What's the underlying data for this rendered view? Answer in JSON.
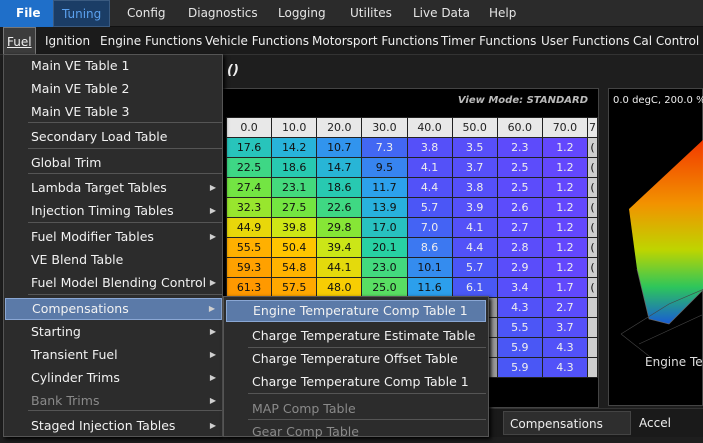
{
  "top_menu": [
    "File",
    "Tuning",
    "Config",
    "Diagnostics",
    "Logging",
    "Utilites",
    "Live Data",
    "Help"
  ],
  "second_menu": [
    "Fuel",
    "Ignition",
    "Engine Functions",
    "Vehicle Functions",
    "Motorsport Functions",
    "Timer Functions",
    "User Functions",
    "Cal Control"
  ],
  "title_fragment": "()",
  "view_mode": "View Mode: STANDARD",
  "table": {
    "headers": [
      "0.0",
      "10.0",
      "20.0",
      "30.0",
      "40.0",
      "50.0",
      "60.0",
      "70.0",
      "7"
    ],
    "rows": [
      [
        "17.6",
        "14.2",
        "10.7",
        "7.3",
        "3.8",
        "3.5",
        "2.3",
        "1.2",
        "("
      ],
      [
        "22.5",
        "18.6",
        "14.7",
        "9.5",
        "4.1",
        "3.7",
        "2.5",
        "1.2",
        "("
      ],
      [
        "27.4",
        "23.1",
        "18.6",
        "11.7",
        "4.4",
        "3.8",
        "2.5",
        "1.2",
        "("
      ],
      [
        "32.3",
        "27.5",
        "22.6",
        "13.9",
        "5.7",
        "3.9",
        "2.6",
        "1.2",
        "("
      ],
      [
        "44.9",
        "39.8",
        "29.8",
        "17.0",
        "7.0",
        "4.1",
        "2.7",
        "1.2",
        "("
      ],
      [
        "55.5",
        "50.4",
        "39.4",
        "20.1",
        "8.6",
        "4.4",
        "2.8",
        "1.2",
        "("
      ],
      [
        "59.3",
        "54.8",
        "44.1",
        "23.0",
        "10.1",
        "5.7",
        "2.9",
        "1.2",
        "("
      ],
      [
        "61.3",
        "57.5",
        "48.0",
        "25.0",
        "11.6",
        "6.1",
        "3.4",
        "1.7",
        "("
      ],
      [
        "",
        "",
        "",
        "",
        "",
        "",
        "4.3",
        "2.7",
        ""
      ],
      [
        "",
        "",
        "",
        "",
        "",
        "",
        "5.5",
        "3.7",
        ""
      ],
      [
        "",
        "",
        "",
        "",
        "",
        "",
        "5.9",
        "4.3",
        ""
      ],
      [
        "",
        "",
        "",
        "",
        "",
        "",
        "5.9",
        "4.3",
        ""
      ]
    ]
  },
  "surface": {
    "header": "0.0 degC, 200.0 %",
    "label": "Engine Te"
  },
  "bottom_tabs": [
    "Compensations",
    "Accel"
  ],
  "fuel_menu": [
    {
      "label": "Main VE Table 1"
    },
    {
      "label": "Main VE Table 2"
    },
    {
      "label": "Main VE Table 3"
    },
    {
      "label": "Secondary Load Table"
    },
    {
      "label": "Global Trim"
    },
    {
      "label": "Lambda Target Tables",
      "submenu": true
    },
    {
      "label": "Injection Timing Tables",
      "submenu": true
    },
    {
      "label": "Fuel Modifier Tables",
      "submenu": true
    },
    {
      "label": "VE Blend Table"
    },
    {
      "label": "Fuel Model Blending Control",
      "submenu": true
    },
    {
      "label": "Compensations",
      "submenu": true
    },
    {
      "label": "Starting",
      "submenu": true
    },
    {
      "label": "Transient Fuel",
      "submenu": true
    },
    {
      "label": "Cylinder Trims",
      "submenu": true
    },
    {
      "label": "Bank Trims",
      "submenu": true
    },
    {
      "label": "Staged Injection Tables",
      "submenu": true
    }
  ],
  "submenu_items": [
    {
      "label": "Engine Temperature Comp Table 1"
    },
    {
      "label": "Charge Temperature Estimate Table"
    },
    {
      "label": "Charge Temperature Offset Table"
    },
    {
      "label": "Charge Temperature Comp Table 1"
    },
    {
      "label": "MAP Comp Table"
    },
    {
      "label": "Gear Comp Table"
    }
  ],
  "colors": {
    "accent": "#1f6fc9",
    "selection": "#5b7aa8"
  }
}
